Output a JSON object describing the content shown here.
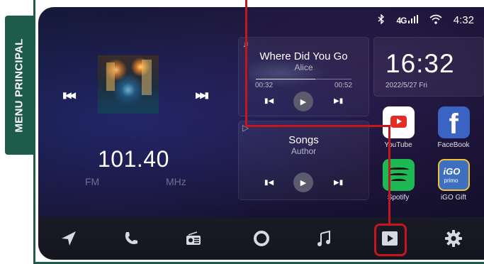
{
  "side_tab": {
    "label": "MENU PRINCIPAL"
  },
  "status_bar": {
    "bluetooth_icon": "bluetooth-icon",
    "signal": "4G",
    "wifi_icon": "wifi-icon",
    "time": "4:32"
  },
  "radio": {
    "prev_icon": "skip-previous-icon",
    "next_icon": "skip-next-icon",
    "frequency": "101.40",
    "band": "FM",
    "unit": "MHz"
  },
  "music_card_1": {
    "title": "Where Did You Go",
    "artist": "Alice",
    "elapsed": "00:32",
    "duration": "00:52",
    "progress": 0.62
  },
  "music_card_2": {
    "title": "Songs",
    "artist": "Author"
  },
  "clock": {
    "time": "16:32",
    "date": "2022/5/27  Fri"
  },
  "apps": [
    {
      "label": "YouTube",
      "icon": "youtube-icon",
      "color": "#e52d27"
    },
    {
      "label": "FaceBook",
      "icon": "facebook-icon",
      "color": "#3b63c4"
    },
    {
      "label": "Spotify",
      "icon": "spotify-icon",
      "color": "#1db954"
    },
    {
      "label": "iGO Gift",
      "icon": "igo-icon",
      "color": "#3f6fc0"
    }
  ],
  "dock": [
    {
      "name": "navigation",
      "icon": "navigation-arrow-icon"
    },
    {
      "name": "phone",
      "icon": "phone-icon"
    },
    {
      "name": "radio",
      "icon": "radio-icon"
    },
    {
      "name": "home",
      "icon": "home-circle-icon"
    },
    {
      "name": "music",
      "icon": "music-note-icon"
    },
    {
      "name": "video",
      "icon": "video-player-icon",
      "highlighted": true
    },
    {
      "name": "settings",
      "icon": "settings-gear-icon"
    }
  ],
  "accent_color": "#c4161c",
  "frame_color": "#1e5b4b"
}
